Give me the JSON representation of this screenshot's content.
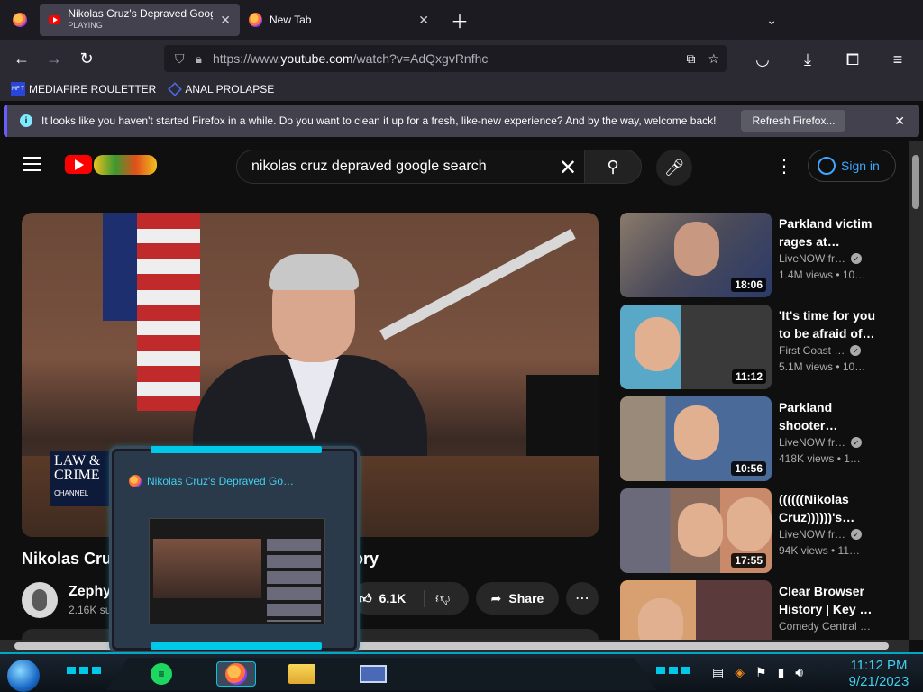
{
  "browser": {
    "tabs": [
      {
        "title": "Nikolas Cruz's Depraved Google Search History",
        "subtitle": "PLAYING",
        "active": true
      },
      {
        "title": "New Tab",
        "active": false
      }
    ],
    "url_prefix": "https://www.",
    "url_host": "youtube.com",
    "url_path": "/watch?v=AdQxgvRnfhc",
    "bookmarks": [
      {
        "label": "MEDIAFIRE ROULETTER",
        "icon": "mediafire-icon",
        "icon_text": "MF T"
      },
      {
        "label": "ANAL PROLAPSE",
        "icon": "folder-icon"
      }
    ],
    "notification": {
      "text": "It looks like you haven't started Firefox in a while. Do you want to clean it up for a fresh, like-new experience? And by the way, welcome back!",
      "button": "Refresh Firefox..."
    }
  },
  "youtube": {
    "search_query": "nikolas cruz depraved google search",
    "signin": "Sign in",
    "video": {
      "title_start": "Nikolas Cruz",
      "title_end": "ory",
      "overlay_logo": "LAW & CRIME",
      "overlay_sub": "CHANNEL",
      "channel": "Zephyr",
      "subs": "2.16K sub",
      "likes": "6.1K",
      "share": "Share"
    },
    "recommended": [
      {
        "title": "Parkland victim rages at…",
        "channel": "LiveNOW fr…",
        "meta": "1.4M views • 10…",
        "duration": "18:06"
      },
      {
        "title": "'It's time for you to be afraid of…",
        "channel": "First Coast …",
        "meta": "5.1M views • 10…",
        "duration": "11:12"
      },
      {
        "title": "Parkland shooter…",
        "channel": "LiveNOW fr…",
        "meta": "418K views • 1…",
        "duration": "10:56"
      },
      {
        "title": "((((((Nikolas Cruz))))))'s…",
        "channel": "LiveNOW fr…",
        "meta": "94K views • 11…",
        "duration": "17:55"
      },
      {
        "title": "Clear Browser History | Key …",
        "channel": "Comedy Central …",
        "meta": "",
        "duration": ""
      }
    ]
  },
  "taskbar": {
    "preview_title": "Nikolas Cruz's Depraved Go…",
    "clock_time": "11:12 PM",
    "clock_date": "9/21/2023"
  },
  "colors": {
    "accent": "#3ea6ff",
    "taskbar_accent": "#00c8e8",
    "youtube_red": "#ff0000"
  }
}
